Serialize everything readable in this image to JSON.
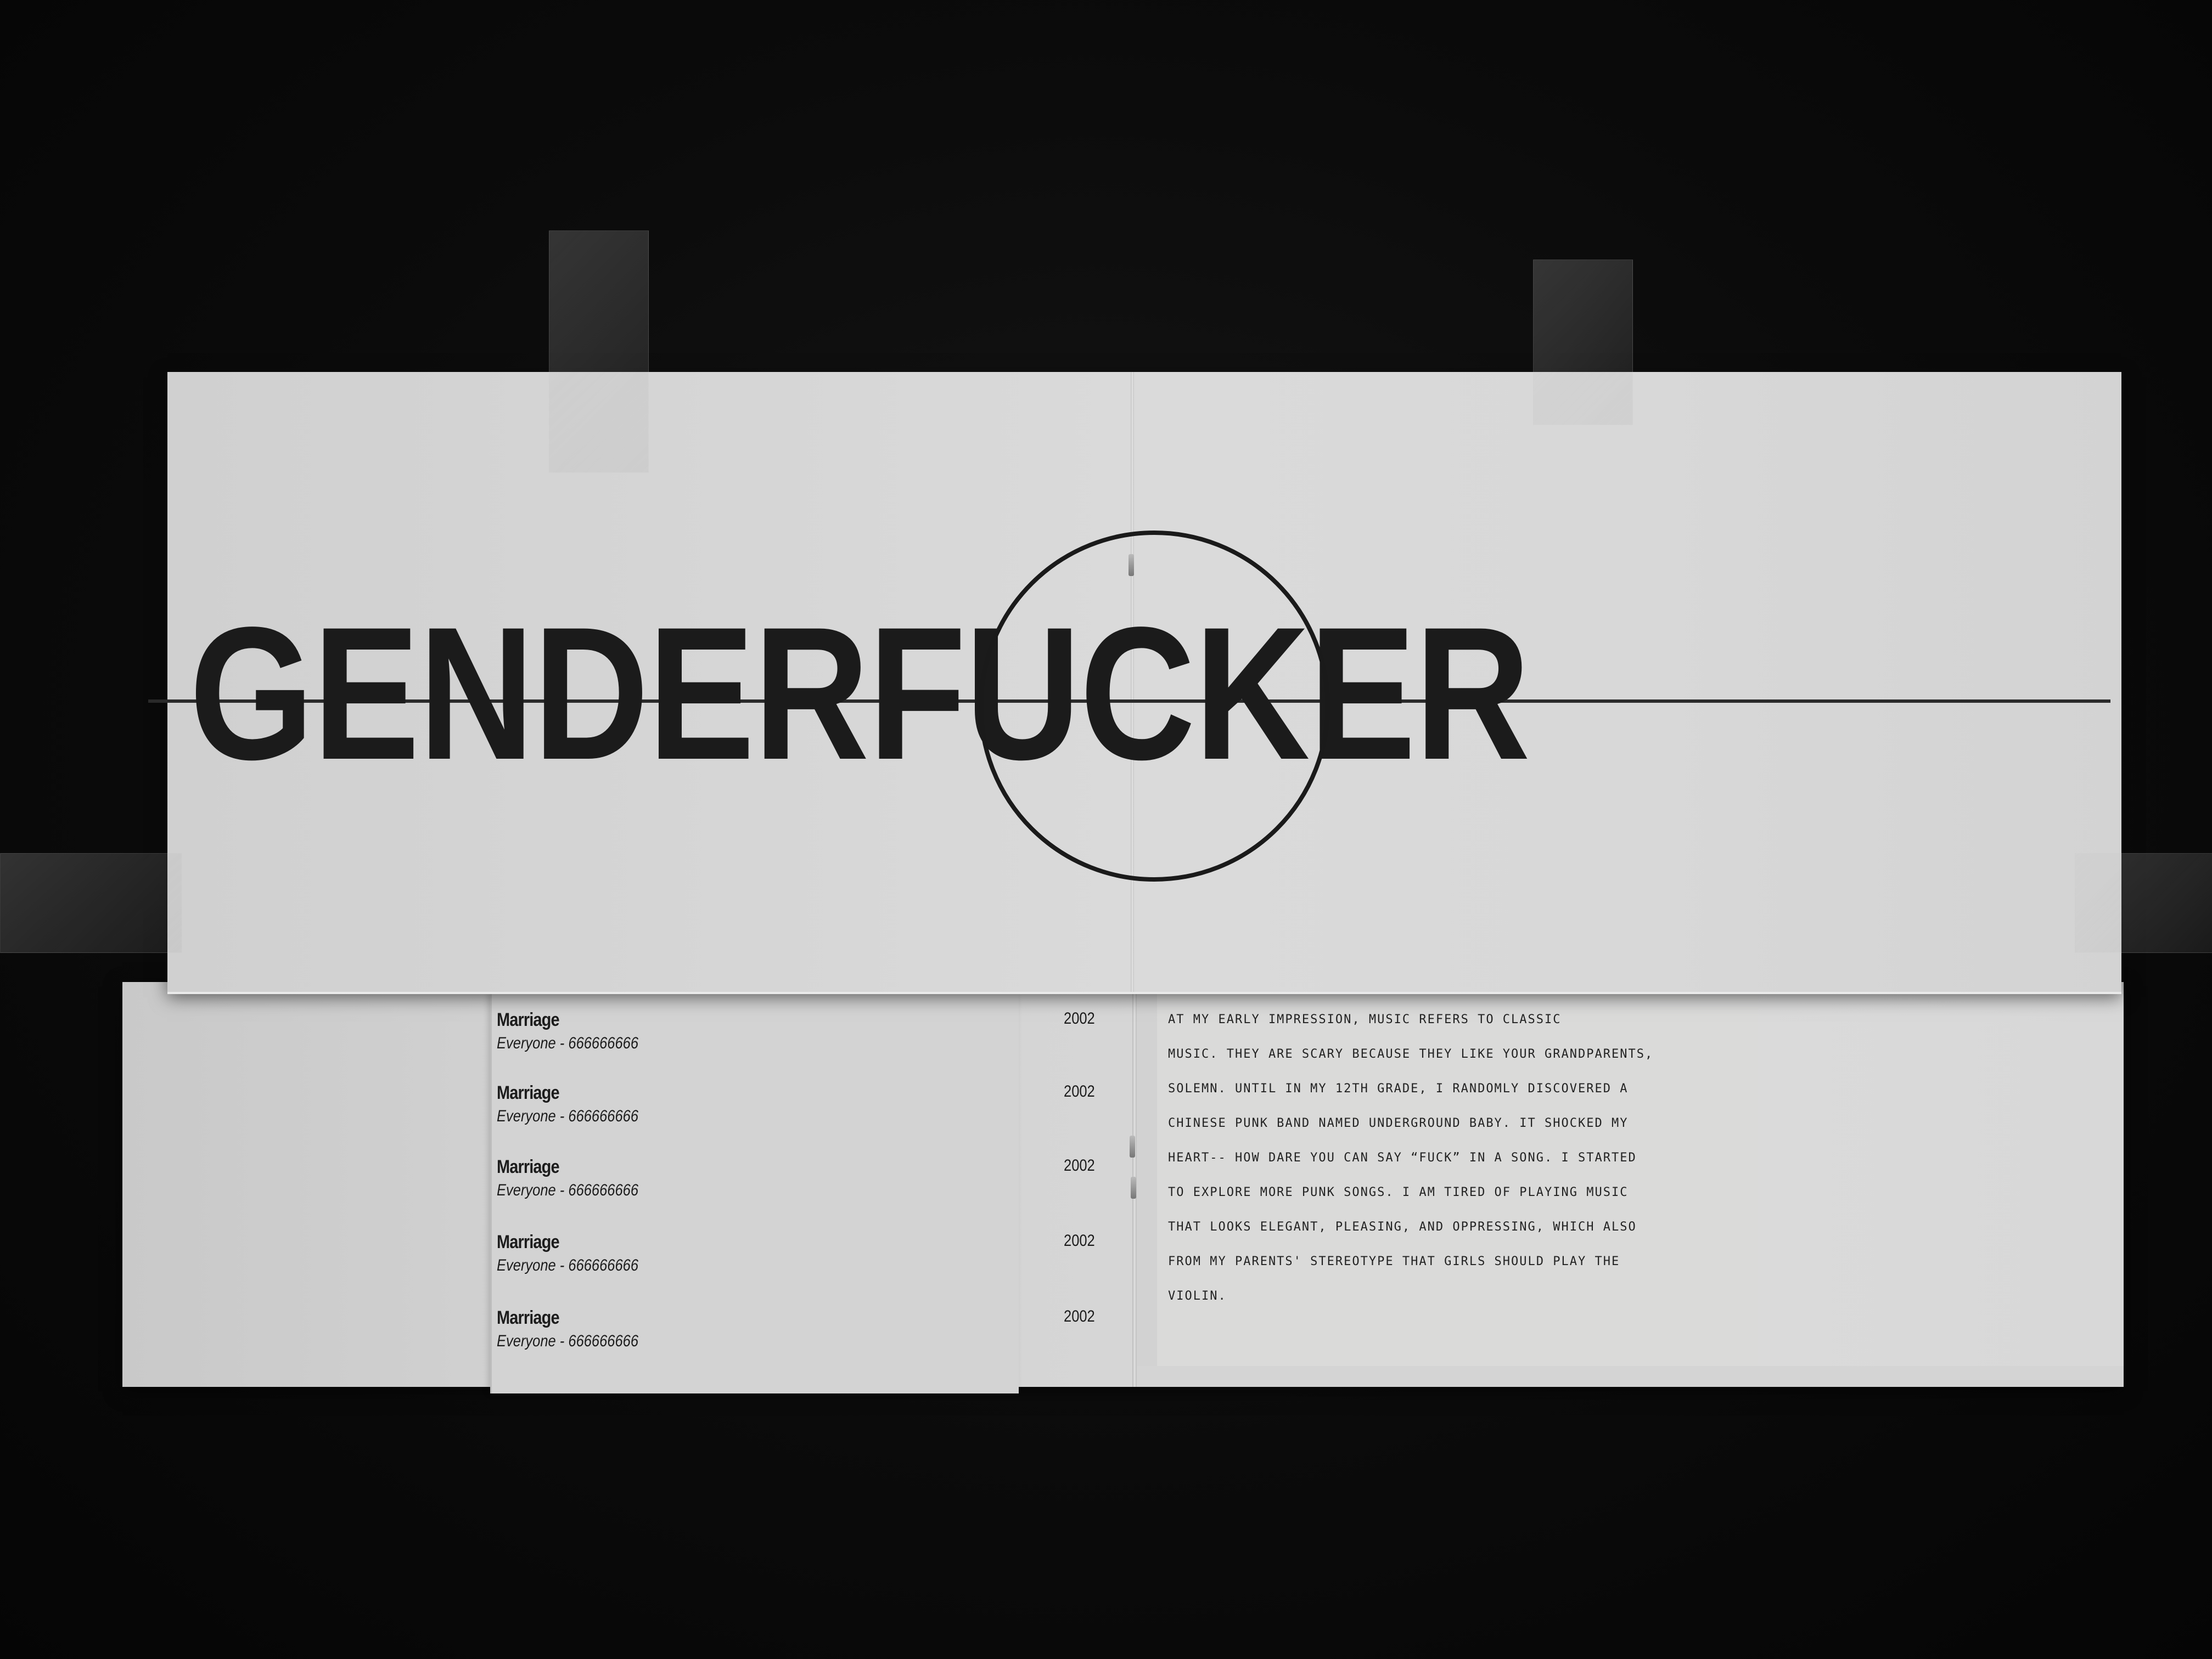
{
  "poster": {
    "headline": "GENDERFUCKER"
  },
  "tracks": [
    {
      "title": "Marriage",
      "artist_line": "Everyone - 666666666",
      "year": "2002"
    },
    {
      "title": "Marriage",
      "artist_line": "Everyone - 666666666",
      "year": "2002"
    },
    {
      "title": "Marriage",
      "artist_line": "Everyone - 666666666",
      "year": "2002"
    },
    {
      "title": "Marriage",
      "artist_line": "Everyone - 666666666",
      "year": "2002"
    },
    {
      "title": "Marriage",
      "artist_line": "Everyone - 666666666",
      "year": "2002"
    }
  ],
  "essay": {
    "lines": [
      "    AT MY EARLY IMPRESSION, MUSIC REFERS TO CLASSIC",
      "MUSIC. THEY ARE SCARY BECAUSE THEY LIKE YOUR GRANDPARENTS,",
      "SOLEMN. UNTIL IN MY 12TH GRADE, I RANDOMLY DISCOVERED A",
      "CHINESE PUNK BAND NAMED UNDERGROUND BABY. IT SHOCKED MY",
      "HEART-- HOW DARE YOU CAN SAY “FUCK” IN A SONG. I STARTED",
      "TO EXPLORE MORE PUNK SONGS. I AM TIRED OF PLAYING MUSIC",
      "THAT LOOKS ELEGANT, PLEASING, AND OPPRESSING, WHICH ALSO",
      "FROM MY PARENTS' STEREOTYPE THAT GIRLS SHOULD PLAY THE",
      "VIOLIN."
    ]
  },
  "colors": {
    "background": "#070707",
    "paper": "#d6d6d6",
    "ink": "#1b1b1b"
  }
}
